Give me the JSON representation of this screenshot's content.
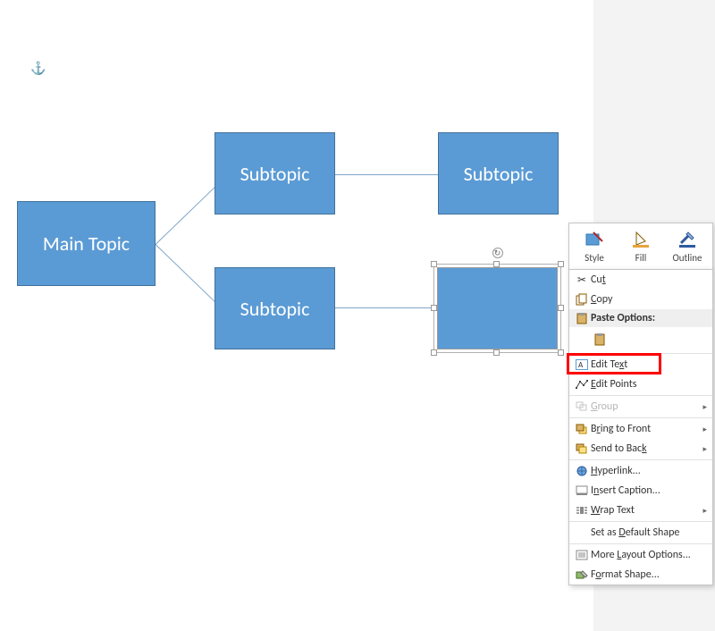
{
  "shapes": {
    "main": "Main Topic",
    "sub1": "Subtopic",
    "sub2": "Subtopic",
    "sub3": "Subtopic",
    "sub4": ""
  },
  "mini_toolbar": {
    "style": "Style",
    "fill": "Fill",
    "outline": "Outline"
  },
  "context_menu": {
    "cut": "Cut",
    "copy": "Copy",
    "paste_header": "Paste Options:",
    "edit_text": "Edit Text",
    "edit_points": "Edit Points",
    "group": "Group",
    "bring_front": "Bring to Front",
    "send_back": "Send to Back",
    "hyperlink": "Hyperlink...",
    "insert_caption": "Insert Caption...",
    "wrap_text": "Wrap Text",
    "default_shape": "Set as Default Shape",
    "more_layout": "More Layout Options...",
    "format_shape": "Format Shape..."
  }
}
